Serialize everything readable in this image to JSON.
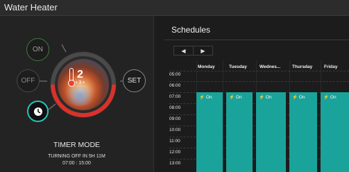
{
  "window": {
    "title": "Water Heater"
  },
  "left": {
    "on_label": "ON",
    "off_label": "OFF",
    "set_label": "SET",
    "dial": {
      "value": "2",
      "sub": "• 3 •"
    },
    "mode_text": "TIMER MODE",
    "turning_text": "TURNING OFF IN 5H 11M",
    "time_range": "07:00 : 15:00"
  },
  "schedules": {
    "title": "Schedules",
    "nav": {
      "prev": "◀",
      "next": "▶"
    },
    "days": [
      "Monday",
      "Tuesday",
      "Wednes...",
      "Thursday",
      "Friday"
    ],
    "hours": [
      "05:00",
      "06:00",
      "07:00",
      "08:00",
      "09:00",
      "10:00",
      "11:00",
      "12:00",
      "13:00"
    ],
    "block_label": "On",
    "colors": {
      "active": "#1aa39a",
      "accent": "#27c3b7",
      "off_arc": "#d9322a"
    }
  }
}
